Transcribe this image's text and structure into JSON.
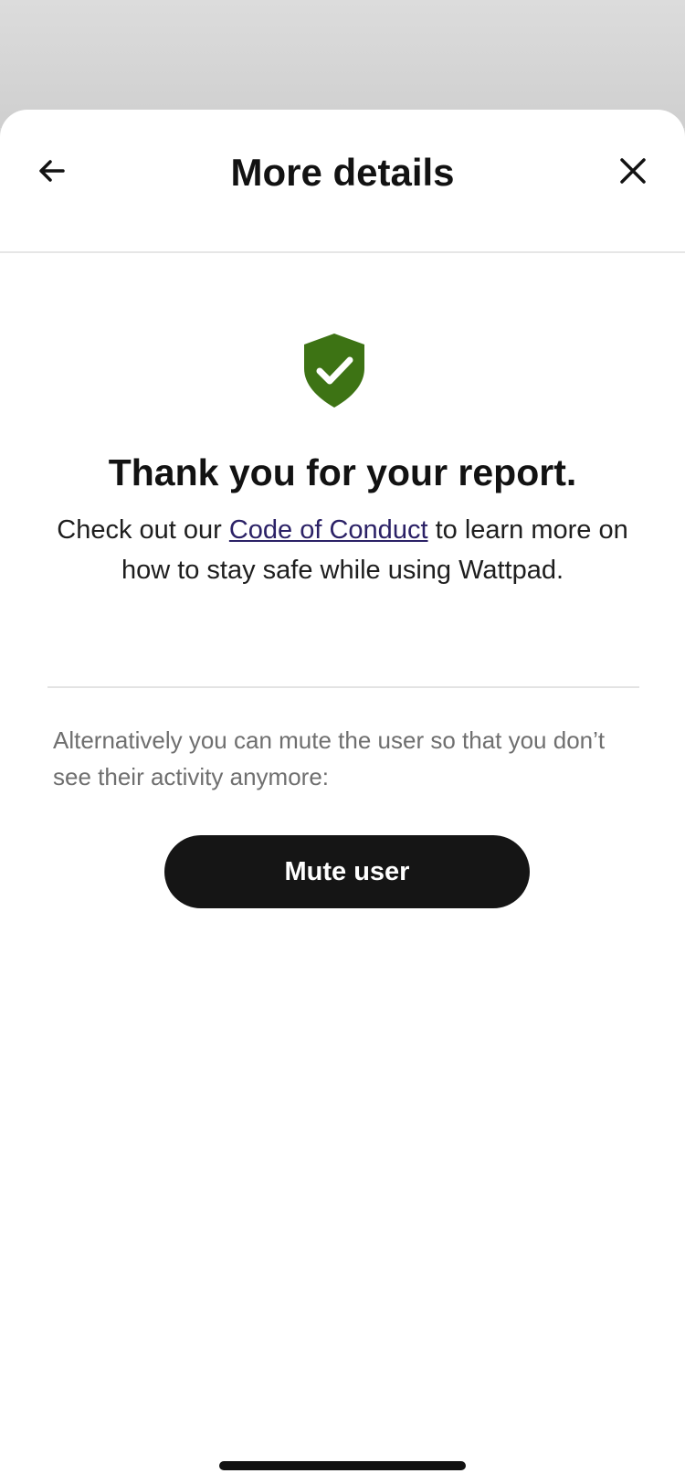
{
  "header": {
    "title": "More details",
    "back_icon": "arrow-left-icon",
    "close_icon": "close-icon"
  },
  "confirmation": {
    "icon": "shield-check-icon",
    "icon_color": "#3d7314",
    "heading": "Thank you for your report.",
    "text_before_link": "Check out our ",
    "link_text": "Code of Conduct",
    "text_after_link": " to learn more on how to stay safe while using Wattpad."
  },
  "mute_section": {
    "description": "Alternatively you can mute the user so that you don’t see their activity anymore:",
    "button_label": "Mute user"
  },
  "colors": {
    "link": "#2b2166",
    "button_bg": "#151515",
    "shield": "#3d7314"
  }
}
